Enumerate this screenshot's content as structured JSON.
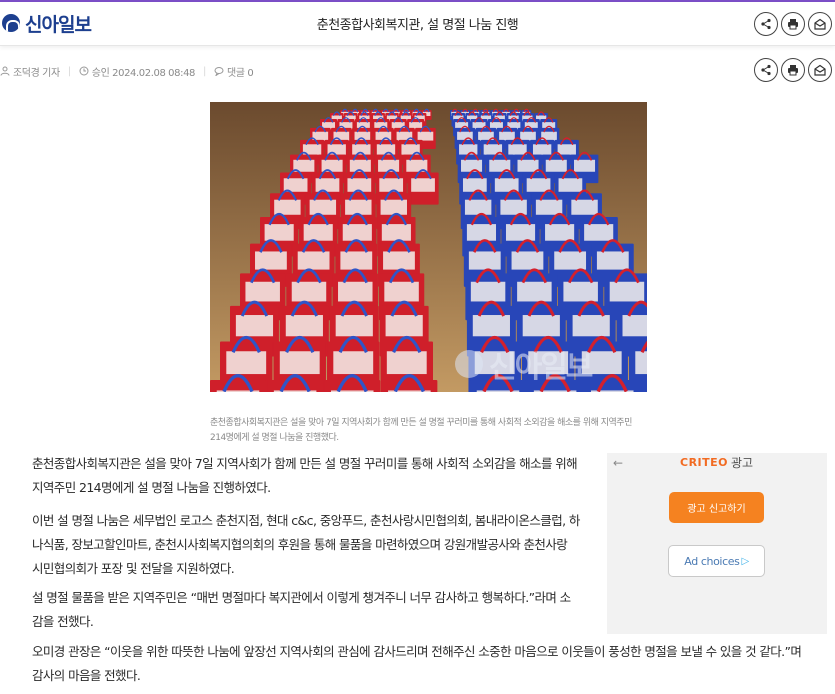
{
  "header": {
    "logo": "신아일보",
    "title": "춘천종합사회복지관, 설 명절 나눔 진행"
  },
  "icons": {
    "share": "share-icon",
    "print": "print-icon",
    "email": "email-icon"
  },
  "meta": {
    "author": "조덕경 기자",
    "approved": "승인 2024.02.08 08:48",
    "comments": "댓글 0"
  },
  "photo": {
    "watermark": "신아일보",
    "caption": "춘천종합사회복지관은 설을 맞아 7일 지역사회가 함께 만든 설 명절 꾸러미를 통해 사회적 소외감을 해소를 위해 지역주민 214명에게 설 명절 나눔을 진행했다."
  },
  "article": {
    "p1": [
      "춘천종합사회복지관은 설을 맞아 7일 지역사회가 함께 만든 설 명절 꾸러미를 통해 사회적 소외감을 해소를 위해",
      "지역주민 214명에게 설 명절 나눔을 진행하였다."
    ],
    "p2": [
      "이번 설 명절 나눔은 세무법인 로고스 춘천지점, 현대 c&c, 중앙푸드, 춘천사랑시민협의회, 봄내라이온스클럽, 하",
      "나식품, 장보고할인마트, 춘천시사회복지협의회의 후원을 통해 물품을 마련하였으며 강원개발공사와 춘천사랑",
      "시민협의회가 포장 및 전달을 지원하였다."
    ],
    "p3": [
      "설 명절 물품을 받은 지역주민은 “매번 명절마다 복지관에서 이렇게 챙겨주니 너무 감사하고 행복하다.”라며 소",
      "감을 전했다."
    ],
    "p4": [
      "오미경 관장은 “이웃을 위한 따뜻한 나눔에 앞장선 지역사회의 관심에 감사드리며 전해주신 소중한 마음으로 이웃들이 풍성한 명절을 보낼 수 있을 것 같다.”며",
      "감사의 마음을 전했다."
    ]
  },
  "ad": {
    "back": "←",
    "brand": "CRITEO",
    "brand_suffix": "광고",
    "report_button": "광고 신고하기",
    "choices": "Ad choices",
    "choices_icon": "▷"
  }
}
